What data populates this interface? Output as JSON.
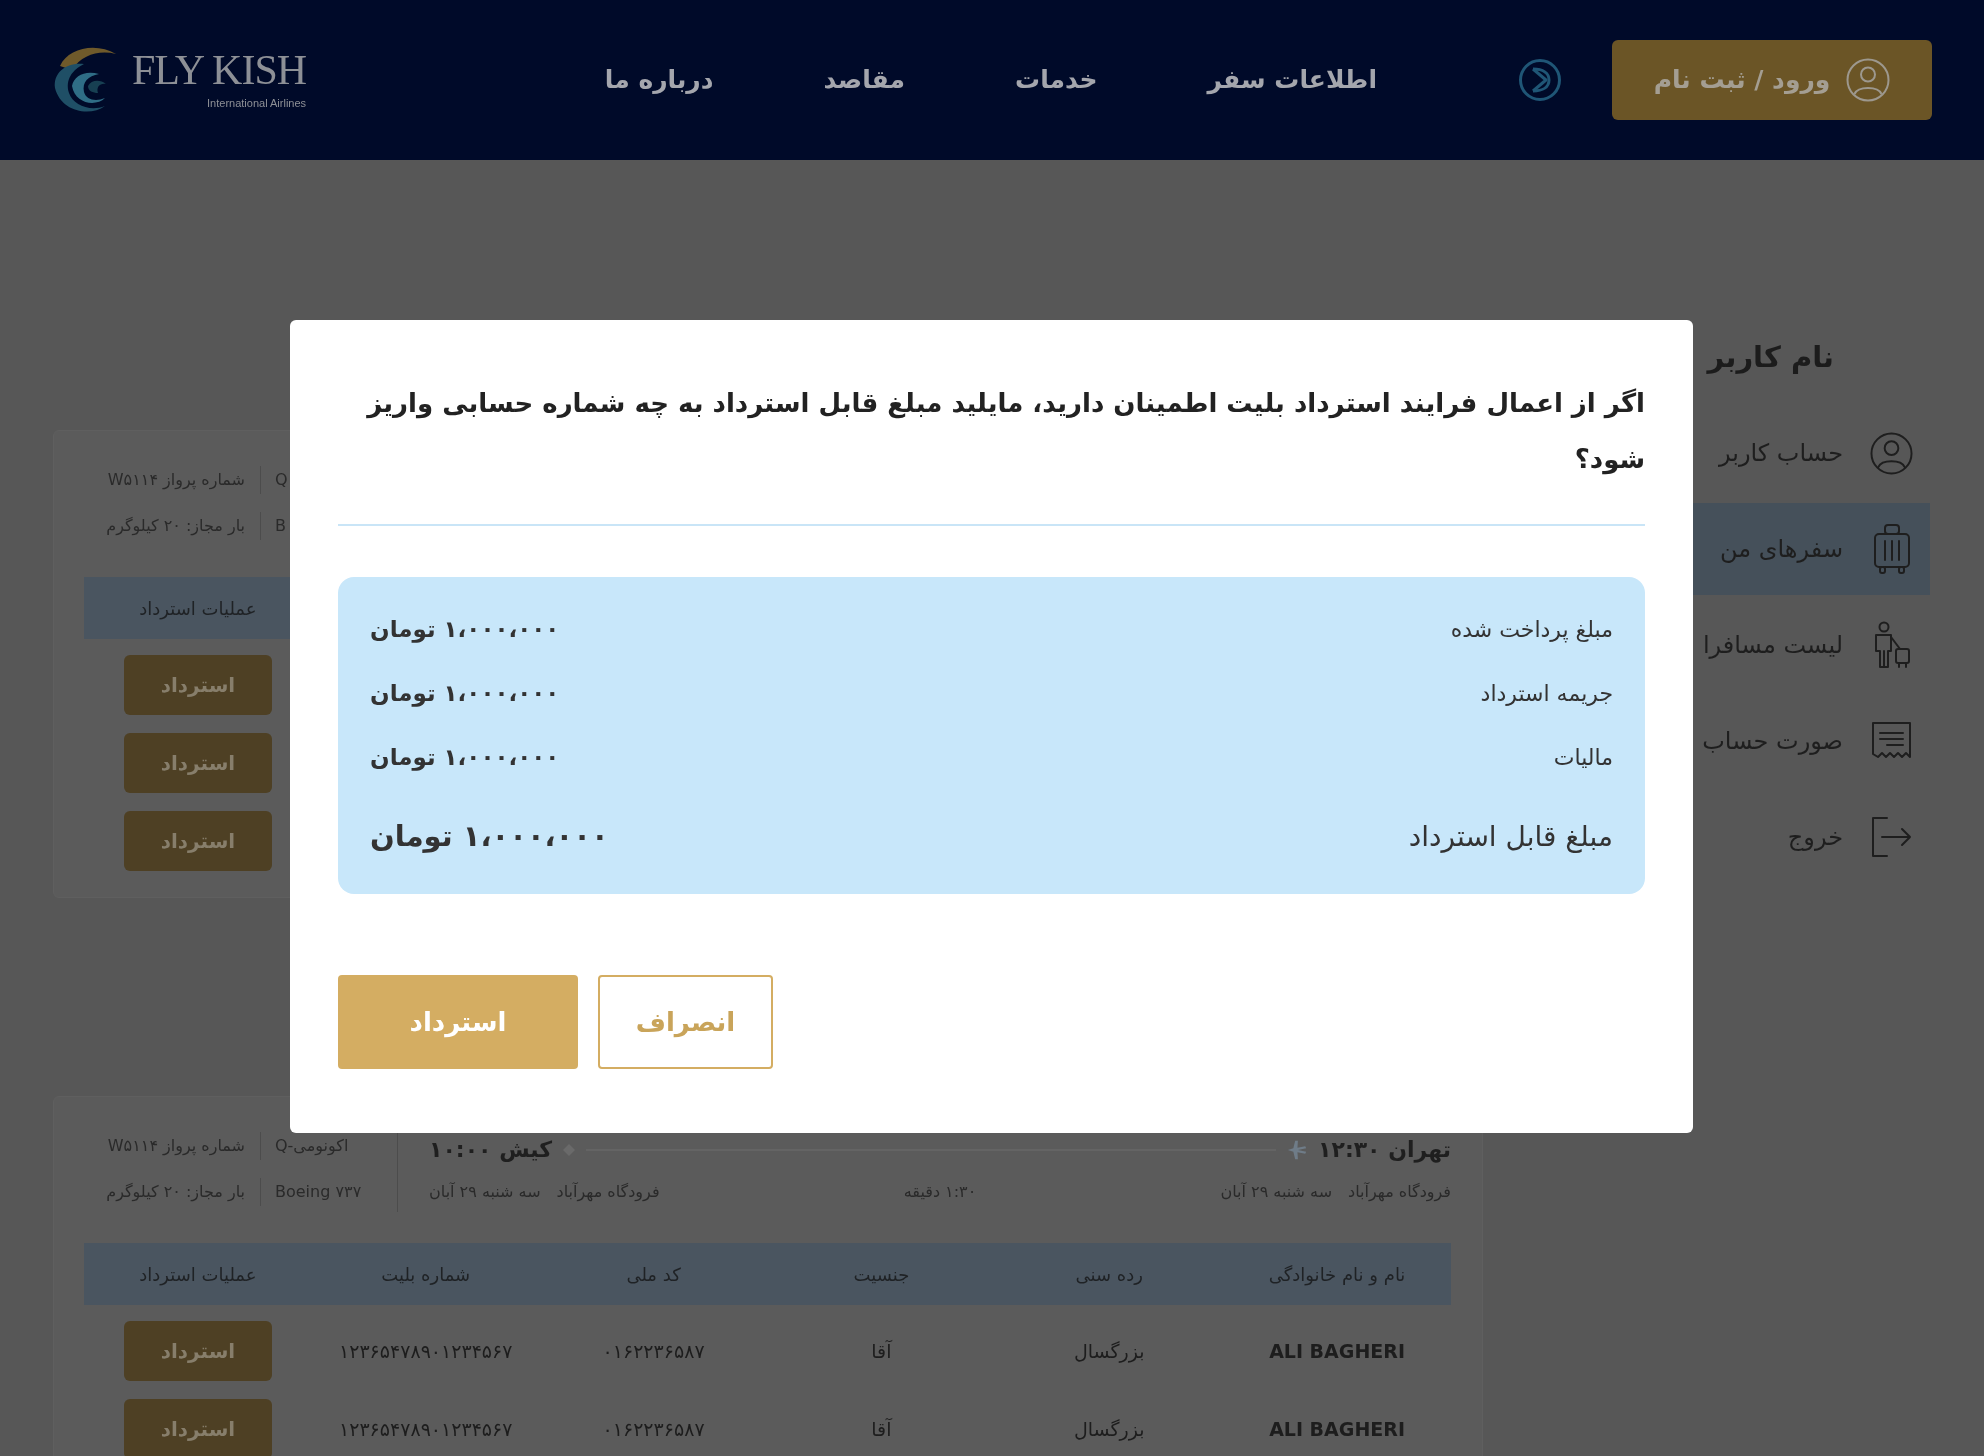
{
  "header": {
    "logo": {
      "brand": "FLY KISH",
      "tagline": "International Airlines"
    },
    "login_button": {
      "label": "ورود / ثبت نام"
    },
    "nav": [
      {
        "label": "اطلاعات سفر"
      },
      {
        "label": "خدمات"
      },
      {
        "label": "مقاصد"
      },
      {
        "label": "درباره ما"
      }
    ]
  },
  "sidebar": {
    "title": "نام کاربر",
    "items": [
      {
        "label": "حساب کاربر",
        "kind": "user",
        "selected": false
      },
      {
        "label": "سفرهای من",
        "kind": "suitcase",
        "selected": true
      },
      {
        "label": "لیست مسافرا",
        "kind": "traveler",
        "selected": false
      },
      {
        "label": "صورت حساب",
        "kind": "receipt",
        "selected": false
      },
      {
        "label": "خروج",
        "kind": "exit",
        "selected": false
      }
    ]
  },
  "bookings": [
    {
      "info_rows": [
        [
          "Q",
          "شماره پرواز W۵۱۱۴"
        ],
        [
          "B",
          "بار مجاز: ۲۰ کیلوگرم"
        ]
      ],
      "table": {
        "columns": [
          "عملیات استرداد"
        ],
        "rows": [
          [
            {
              "kind": "button",
              "text": "استرداد"
            }
          ],
          [
            {
              "kind": "button",
              "text": "استرداد"
            }
          ],
          [
            {
              "kind": "button",
              "text": "استرداد"
            }
          ]
        ]
      }
    },
    {
      "route": {
        "origin": {
          "city_time": "تهران ۱۲:۳۰",
          "airport": "فرودگاه مهرآباد",
          "date": "سه شنبه ۲۹ آبان"
        },
        "duration": "۱:۳۰ دقیقه",
        "destination": {
          "city_time": "کیش ۱۰:۰۰",
          "airport": "فرودگاه مهرآباد",
          "date": "سه شنبه ۲۹ آبان"
        }
      },
      "info_rows": [
        [
          "اکونومی-Q",
          "شماره پرواز W۵۱۱۴"
        ],
        [
          "Boeing ۷۳۷",
          "بار مجاز: ۲۰ کیلوگرم"
        ]
      ],
      "table": {
        "columns": [
          "نام و نام خانوادگی",
          "رده سنی",
          "جنسیت",
          "کد ملی",
          "شماره بلیت",
          "عملیات استرداد"
        ],
        "rows": [
          [
            {
              "kind": "name",
              "text": "ALI BAGHERI"
            },
            {
              "kind": "text",
              "text": "بزرگسال"
            },
            {
              "kind": "text",
              "text": "آقا"
            },
            {
              "kind": "text",
              "text": "۰۱۶۲۲۳۶۵۸۷"
            },
            {
              "kind": "text",
              "text": "۱۲۳۶۵۴۷۸۹۰۱۲۳۴۵۶۷"
            },
            {
              "kind": "button",
              "text": "استرداد"
            }
          ],
          [
            {
              "kind": "name",
              "text": "ALI BAGHERI"
            },
            {
              "kind": "text",
              "text": "بزرگسال"
            },
            {
              "kind": "text",
              "text": "آقا"
            },
            {
              "kind": "text",
              "text": "۰۱۶۲۲۳۶۵۸۷"
            },
            {
              "kind": "text",
              "text": "۱۲۳۶۵۴۷۸۹۰۱۲۳۴۵۶۷"
            },
            {
              "kind": "button",
              "text": "استرداد"
            }
          ]
        ]
      }
    }
  ],
  "modal": {
    "title": "اگر از اعمال فرایند استرداد بلیت اطمینان دارید، مایلید مبلغ قابل استرداد به چه شماره حسابی واریز شود؟",
    "summary": [
      {
        "kind": "item",
        "label": "مبلغ پرداخت شده",
        "value": "۱،۰۰۰،۰۰۰ تومان"
      },
      {
        "kind": "item",
        "label": "جریمه استرداد",
        "value": "۱،۰۰۰،۰۰۰ تومان"
      },
      {
        "kind": "item",
        "label": "مالیات",
        "value": "۱،۰۰۰،۰۰۰ تومان"
      },
      {
        "kind": "total",
        "label": "مبلغ قابل استرداد",
        "value": "۱،۰۰۰،۰۰۰ تومان"
      }
    ],
    "buttons": [
      {
        "kind": "outline",
        "label": "انصراف"
      },
      {
        "kind": "primary",
        "label": "استرداد"
      }
    ]
  }
}
